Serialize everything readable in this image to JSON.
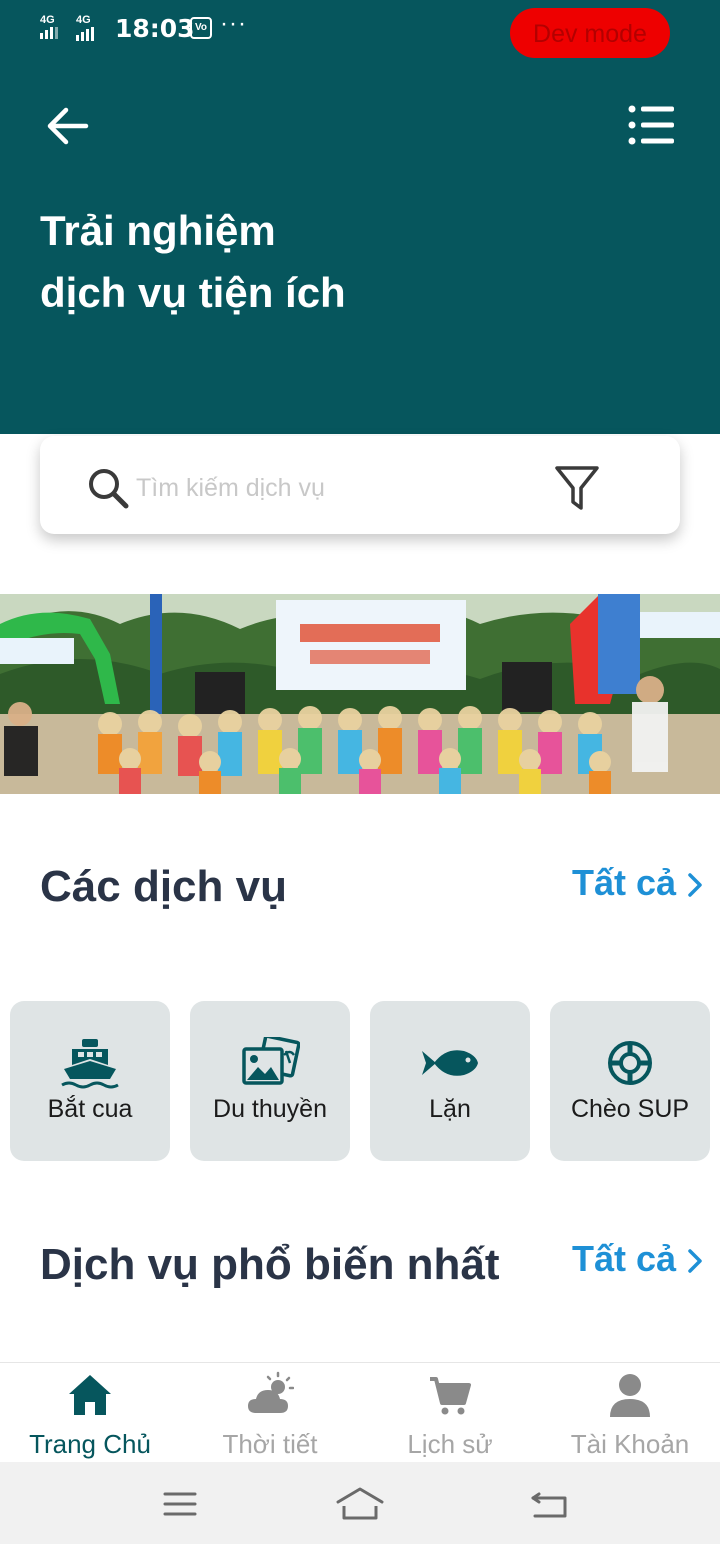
{
  "status_bar": {
    "network_1": "4G",
    "network_2": "4G",
    "time": "18:03",
    "vo_badge": "Vo",
    "more_dots": "···",
    "dev_mode": "Dev mode"
  },
  "header": {
    "title_line1": "Trải nghiệm",
    "title_line2": "dịch vụ tiện ích",
    "background_color": "#06565d"
  },
  "search": {
    "placeholder": "Tìm kiếm dịch vụ",
    "value": ""
  },
  "sections": {
    "services": {
      "title": "Các dịch vụ",
      "see_all": "Tất cả"
    },
    "popular": {
      "title": "Dịch vụ phổ biến nhất",
      "see_all": "Tất cả"
    }
  },
  "services": [
    {
      "label": "Bắt cua",
      "icon": "ship-icon"
    },
    {
      "label": "Du thuyền",
      "icon": "photos-icon"
    },
    {
      "label": "Lặn",
      "icon": "fish-icon"
    },
    {
      "label": "Chèo SUP",
      "icon": "lifebuoy-icon"
    }
  ],
  "bottom_nav": [
    {
      "label": "Trang Chủ",
      "icon": "home-icon",
      "active": true
    },
    {
      "label": "Thời tiết",
      "icon": "weather-icon",
      "active": false
    },
    {
      "label": "Lịch sử",
      "icon": "cart-icon",
      "active": false
    },
    {
      "label": "Tài Khoản",
      "icon": "user-icon",
      "active": false
    }
  ],
  "colors": {
    "primary": "#06565d",
    "accent_link": "#1e90d6",
    "card_bg": "#dfe4e5",
    "dev_badge": "#ee0000"
  }
}
